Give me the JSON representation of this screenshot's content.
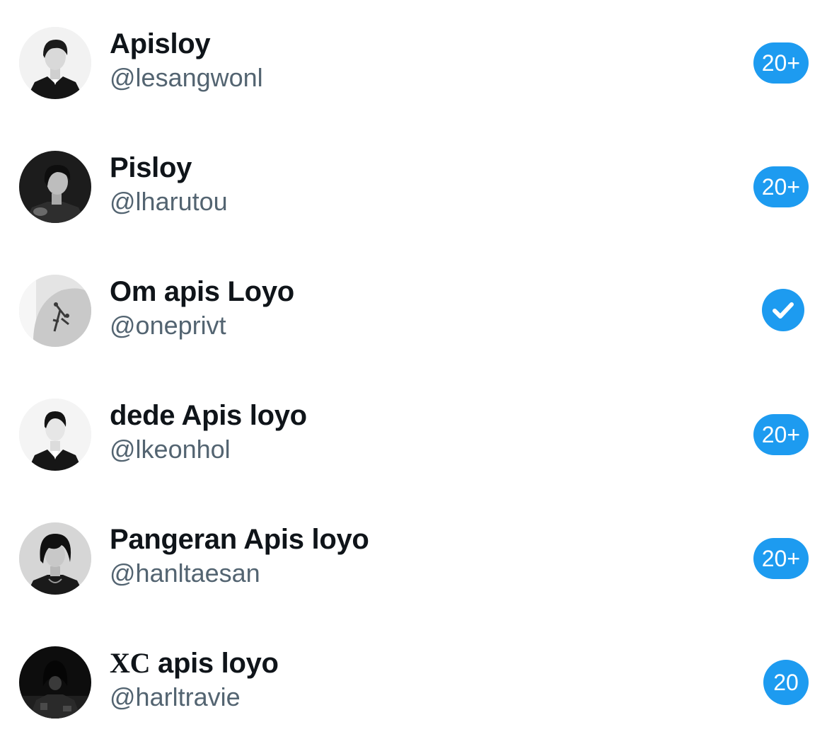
{
  "accounts": [
    {
      "name": "Apisloy",
      "handle": "@lesangwonl",
      "badge": "20+",
      "avatar_icon": "profile-photo-man-suit"
    },
    {
      "name": "Pisloy",
      "handle": "@lharutou",
      "badge": "20+",
      "avatar_icon": "profile-photo-man-dark"
    },
    {
      "name": "Om apis Loyo",
      "handle": "@oneprivt",
      "status": "selected",
      "avatar_icon": "profile-photo-shoulder-tattoo"
    },
    {
      "name": "dede Apis loyo",
      "handle": "@lkeonhol",
      "badge": "20+",
      "avatar_icon": "profile-photo-man-suit-portrait"
    },
    {
      "name": "Pangeran Apis loyo",
      "handle": "@hanltaesan",
      "badge": "20+",
      "avatar_icon": "profile-photo-man-shaggy-hair"
    },
    {
      "name_prefix": "XC",
      "name": "apis loyo",
      "handle": "@harltravie",
      "badge": "20",
      "avatar_icon": "profile-photo-hooded-figure"
    }
  ],
  "colors": {
    "accent": "#1d9bf0",
    "name_text": "#0f1419",
    "handle_text": "#536471"
  }
}
